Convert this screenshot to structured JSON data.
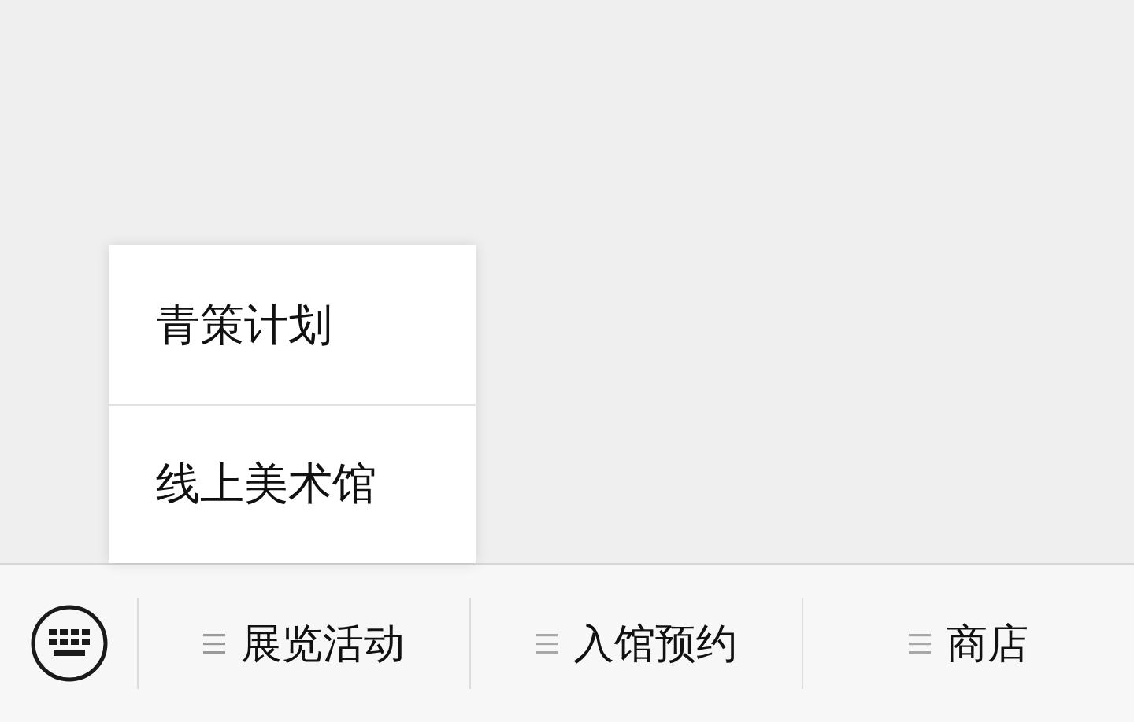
{
  "menu_bar": {
    "items": [
      {
        "label": "展览活动",
        "expanded": true,
        "submenu": [
          "青策计划",
          "线上美术馆"
        ]
      },
      {
        "label": "入馆预约",
        "expanded": false
      },
      {
        "label": "商店",
        "expanded": false
      }
    ]
  }
}
